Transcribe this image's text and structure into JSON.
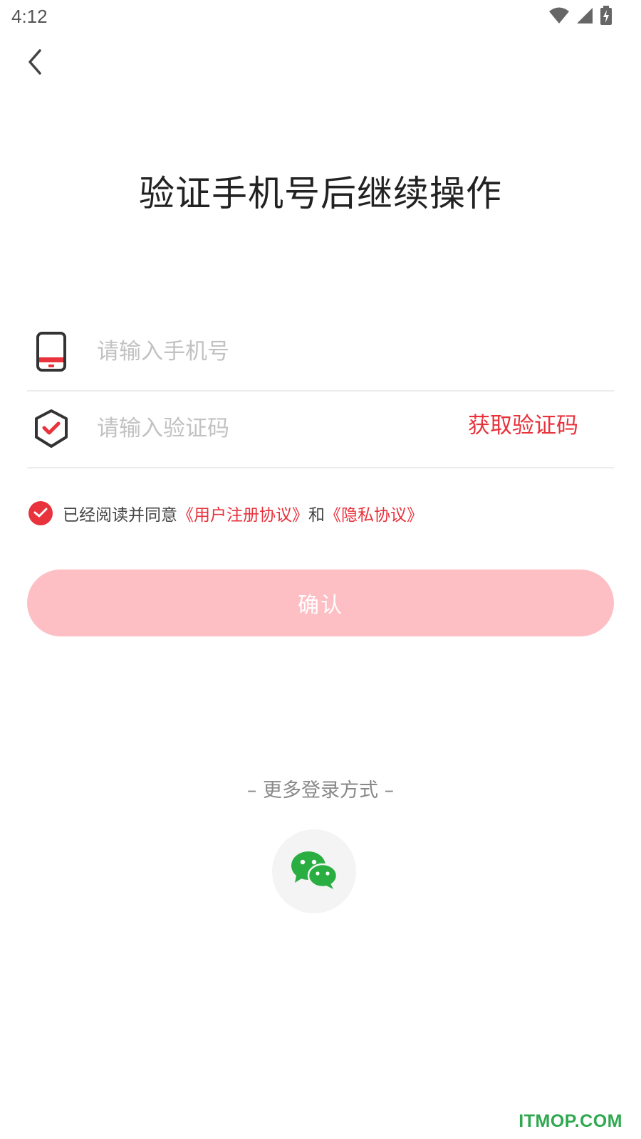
{
  "status_bar": {
    "time": "4:12",
    "icons": [
      "wifi-icon",
      "cell-signal-icon",
      "battery-charging-icon"
    ]
  },
  "header": {
    "back_icon": "chevron-left-icon"
  },
  "title": "验证手机号后继续操作",
  "phone_field": {
    "icon": "phone-icon",
    "placeholder": "请输入手机号",
    "value": ""
  },
  "code_field": {
    "icon": "shield-check-icon",
    "placeholder": "请输入验证码",
    "value": "",
    "get_code_label": "获取验证码"
  },
  "agreement": {
    "checked": true,
    "prefix": "已经阅读并同意",
    "link1": "《用户注册协议》",
    "conjunction": "和",
    "link2": "《隐私协议》"
  },
  "confirm_button": {
    "label": "确认"
  },
  "more_login": {
    "label": "– 更多登录方式 –",
    "options": [
      "wechat-icon"
    ]
  },
  "watermark": "ITMOP.COM",
  "colors": {
    "accent": "#e8323c",
    "button_disabled": "#fdbfc4",
    "wechat_green": "#2aae42",
    "placeholder": "#c2c2c2"
  }
}
